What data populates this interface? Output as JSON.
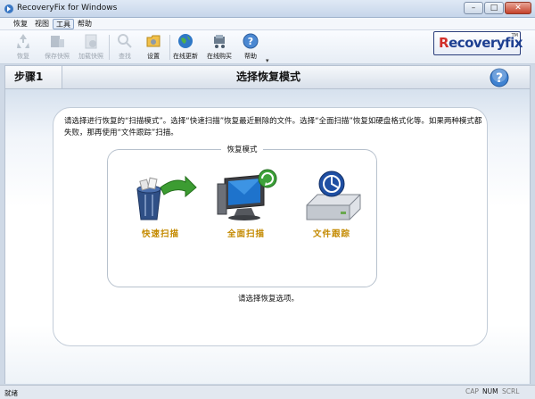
{
  "window": {
    "title": "RecoveryFix for Windows",
    "minimize": "–",
    "maximize": "□",
    "close": "✕"
  },
  "menu": [
    "恢复",
    "视图",
    "工具",
    "帮助"
  ],
  "toolbar": {
    "items": [
      {
        "label": "恢复",
        "icon": "recycle-icon",
        "enabled": false
      },
      {
        "label": "保存快照",
        "icon": "save-snapshot-icon",
        "enabled": false
      },
      {
        "label": "加载快照",
        "icon": "load-snapshot-icon",
        "enabled": false
      },
      {
        "label": "查找",
        "icon": "find-icon",
        "enabled": false
      },
      {
        "label": "设置",
        "icon": "settings-icon",
        "enabled": true
      },
      {
        "label": "在线更新",
        "icon": "globe-icon",
        "enabled": true
      },
      {
        "label": "在线购买",
        "icon": "cart-icon",
        "enabled": true
      },
      {
        "label": "帮助",
        "icon": "help-icon",
        "enabled": true
      }
    ],
    "more": "▾"
  },
  "logo": {
    "first": "R",
    "rest": "ecoveryfix",
    "tm": "TM"
  },
  "step": {
    "label": "步骤1",
    "title": "选择恢复模式"
  },
  "instructions": "请选择进行恢复的“扫描模式”。选择“快速扫描”恢复最近删除的文件。选择“全面扫描”恢复如硬盘格式化等。如果两种模式都失败，那再使用“文件跟踪”扫描。",
  "modes": {
    "title": "恢复模式",
    "items": [
      {
        "label": "快速扫描",
        "icon": "quick-scan-icon"
      },
      {
        "label": "全面扫描",
        "icon": "full-scan-icon"
      },
      {
        "label": "文件跟踪",
        "icon": "file-trace-icon"
      }
    ]
  },
  "note": "请选择恢复选项。",
  "status": {
    "text": "就绪",
    "caps": "CAP",
    "num": "NUM",
    "scroll": "SCRL"
  },
  "colors": {
    "accent_label": "#c48a00",
    "logo_red": "#d2302a",
    "logo_blue": "#1d3f91"
  }
}
